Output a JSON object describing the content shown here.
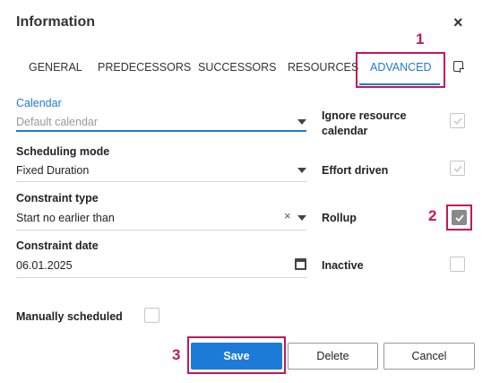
{
  "dialog": {
    "title": "Information",
    "close_icon": "×"
  },
  "tabs": [
    {
      "label": "GENERAL",
      "active": false
    },
    {
      "label": "PREDECESSORS",
      "active": false
    },
    {
      "label": "SUCCESSORS",
      "active": false
    },
    {
      "label": "RESOURCES",
      "active": false
    },
    {
      "label": "ADVANCED",
      "active": true
    }
  ],
  "markers": {
    "one": "1",
    "two": "2",
    "three": "3"
  },
  "form": {
    "calendar": {
      "label": "Calendar",
      "placeholder": "Default calendar"
    },
    "scheduling_mode": {
      "label": "Scheduling mode",
      "value": "Fixed Duration"
    },
    "constraint_type": {
      "label": "Constraint type",
      "value": "Start no earlier than",
      "clear_icon": "×"
    },
    "constraint_date": {
      "label": "Constraint date",
      "value": "06.01.2025"
    },
    "manually_scheduled": {
      "label": "Manually scheduled",
      "checked": false
    }
  },
  "options": {
    "ignore_resource_calendar": {
      "label_line1": "Ignore resource",
      "label_line2": "calendar",
      "checked": true
    },
    "effort_driven": {
      "label": "Effort driven",
      "checked": true
    },
    "rollup": {
      "label": "Rollup",
      "checked": true
    },
    "inactive": {
      "label": "Inactive",
      "checked": false
    }
  },
  "buttons": {
    "save": "Save",
    "delete": "Delete",
    "cancel": "Cancel"
  },
  "colors": {
    "accent": "#1e7ad7",
    "highlight": "#c2185b"
  }
}
